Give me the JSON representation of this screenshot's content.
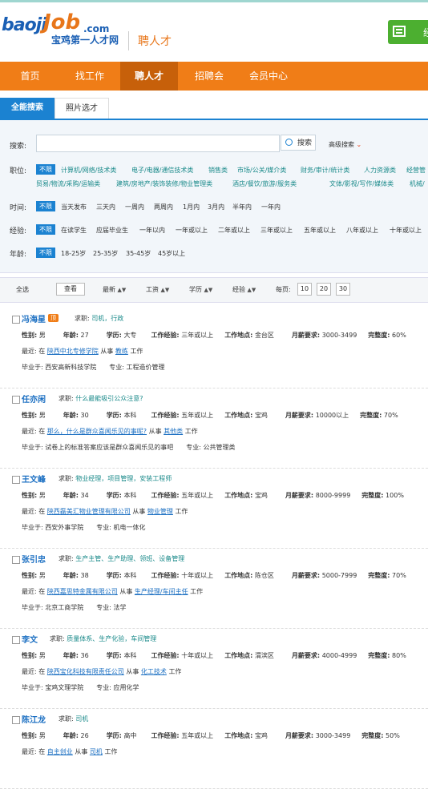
{
  "header": {
    "logo_word1": "baoji",
    "logo_word2": "Job",
    "logo_tld": ".com",
    "logo_sub": "宝鸡第一人才网",
    "title": "聘人才",
    "btn_text": "经"
  },
  "nav": [
    "首页",
    "找工作",
    "聘人才",
    "招聘会",
    "会员中心"
  ],
  "tabs": [
    "全能搜索",
    "照片选才"
  ],
  "filters": {
    "search_label": "搜索:",
    "search_btn": "搜索",
    "advanced": "高级搜索",
    "job_label": "职位:",
    "job_unlimited": "不限",
    "job_row1": [
      "计算机/网络/技术类",
      "电子/电器/通信技术类",
      "销售类",
      "市场/公关/媒介类",
      "财务/审计/统计类",
      "人力资源类",
      "经营管"
    ],
    "job_row2": [
      "贸易/物流/采购/运输类",
      "建筑/房地产/装饰装修/物业管理类",
      "酒店/餐饮/旅游/服务类",
      "文体/影视/写作/媒体类",
      "机械/"
    ],
    "time_label": "时间:",
    "time_unlimited": "不限",
    "time_opts": [
      "当天发布",
      "三天内",
      "一周内",
      "两周内",
      "1月内",
      "3月内",
      "半年内",
      "一年内"
    ],
    "exp_label": "经验:",
    "exp_unlimited": "不限",
    "exp_opts": [
      "在读学生",
      "应届毕业生",
      "一年以内",
      "一年或以上",
      "二年或以上",
      "三年或以上",
      "五年或以上",
      "八年或以上",
      "十年或以上"
    ],
    "age_label": "年龄:",
    "age_unlimited": "不限",
    "age_opts": [
      "18-25岁",
      "25-35岁",
      "35-45岁",
      "45岁以上"
    ]
  },
  "toolbar": {
    "select_all": "全选",
    "view": "查看",
    "sort_new": "最新",
    "sort_salary": "工资",
    "sort_edu": "学历",
    "sort_exp": "经验",
    "per_page": "每页:",
    "page_sizes": [
      "10",
      "20",
      "30"
    ]
  },
  "labels": {
    "want": "求职:",
    "gender": "性别:",
    "age": "年龄:",
    "edu": "学历:",
    "exp": "工作经验:",
    "place": "工作地点:",
    "salary": "月薪要求:",
    "complete": "完整度:",
    "recent": "最近: 在",
    "engaged": "从事",
    "work": "工作",
    "grad": "毕业于:",
    "major": "专业:",
    "top": "顶"
  },
  "candidates": [
    {
      "name": "冯海星",
      "top": true,
      "want": "司机，行政",
      "gender": "男",
      "age": "27",
      "edu": "大专",
      "exp": "三年或以上",
      "place": "金台区",
      "salary": "3000-3499",
      "complete": "60%",
      "recent_co": "陕西中北专修学院",
      "recent_job": "教练",
      "school": "西安高新科技学院",
      "major": "工程造价管理"
    },
    {
      "name": "任亦闲",
      "top": false,
      "want": "什么最能吸引公众注意?",
      "gender": "男",
      "age": "30",
      "edu": "本科",
      "exp": "五年或以上",
      "place": "宝鸡",
      "salary": "10000以上",
      "complete": "70%",
      "recent_co": "那么，什么是群众喜闻乐见的事呢?",
      "recent_job": "其他类",
      "school": "试卷上的标准答案应该是群众喜闻乐见的事吧",
      "major": "公共管理类"
    },
    {
      "name": "王文峰",
      "top": false,
      "want": "物业经理，项目管理，安装工程师",
      "gender": "男",
      "age": "34",
      "edu": "本科",
      "exp": "五年或以上",
      "place": "宝鸡",
      "salary": "8000-9999",
      "complete": "100%",
      "recent_co": "陕西磊美汇物业管理有限公司",
      "recent_job": "物业管理",
      "school": "西安外事学院",
      "major": "机电一体化"
    },
    {
      "name": "张引忠",
      "top": false,
      "want": "生产主管、生产助理、领班、设备管理",
      "gender": "男",
      "age": "38",
      "edu": "本科",
      "exp": "十年或以上",
      "place": "陈仓区",
      "salary": "5000-7999",
      "complete": "70%",
      "recent_co": "陕西嘉思特金属有限公司",
      "recent_job": "生产经理/车间主任",
      "school": "北京工商学院",
      "major": "法学"
    },
    {
      "name": "李文",
      "top": false,
      "want": "质量体系、生产化验，车间管理",
      "gender": "男",
      "age": "36",
      "edu": "本科",
      "exp": "十年或以上",
      "place": "渭滨区",
      "salary": "4000-4999",
      "complete": "80%",
      "recent_co": "陕西宝化科技有限责任公司",
      "recent_job": "化工技术",
      "school": "宝鸡文理学院",
      "major": "应用化学"
    },
    {
      "name": "陈江龙",
      "top": false,
      "want": "司机",
      "gender": "男",
      "age": "26",
      "edu": "高中",
      "exp": "五年或以上",
      "place": "宝鸡",
      "salary": "3000-3499",
      "complete": "50%",
      "recent_co": "自主创业",
      "recent_job": "司机",
      "school": "",
      "major": ""
    }
  ]
}
